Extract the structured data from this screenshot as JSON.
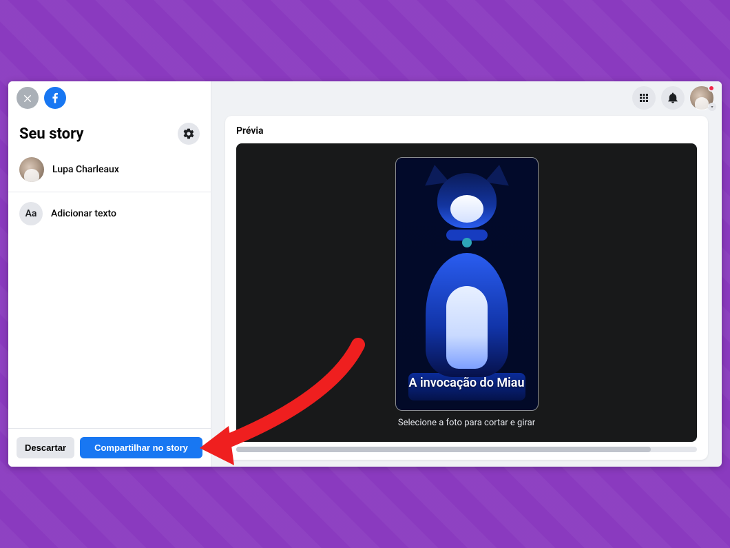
{
  "sidebar": {
    "title": "Seu story",
    "user_name": "Lupa Charleaux",
    "add_text_label": "Adicionar texto",
    "discard_label": "Descartar",
    "share_label": "Compartilhar no story"
  },
  "preview": {
    "title": "Prévia",
    "hint": "Selecione a foto para cortar e girar",
    "story_text": "A invocação do Miau"
  },
  "icons": {
    "text_aa": "Aa"
  }
}
